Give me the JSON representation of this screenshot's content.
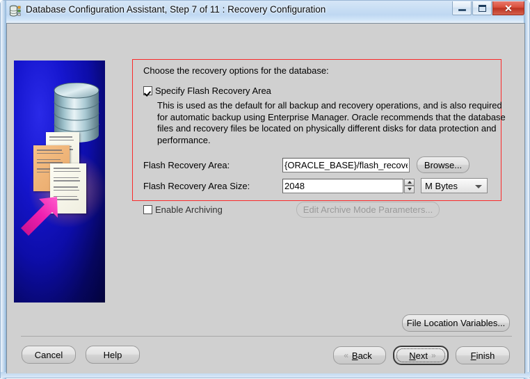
{
  "window": {
    "title": "Database Configuration Assistant, Step 7 of 11 : Recovery Configuration",
    "icon": "database-icon",
    "controls": {
      "minimize": "minimize-icon",
      "maximize": "maximize-icon",
      "close": "✕"
    }
  },
  "content": {
    "prompt": "Choose the recovery options for the database:",
    "specify_flash_recovery_area": {
      "label": "Specify Flash Recovery Area",
      "checked": true
    },
    "description": "This is used as the default for all backup and recovery operations, and is also required for automatic backup using Enterprise Manager. Oracle recommends that the database files and recovery files be located on physically different disks for data protection and performance.",
    "fields": [
      {
        "label": "Flash Recovery Area:",
        "value": "{ORACLE_BASE}/flash_recovery_",
        "button": "Browse..."
      },
      {
        "label": "Flash Recovery Area Size:",
        "value": "2048",
        "unit": "M Bytes"
      }
    ],
    "enable_archiving": {
      "label": "Enable Archiving",
      "checked": false
    },
    "edit_archive_button": {
      "label": "Edit Archive Mode Parameters...",
      "enabled": false
    },
    "file_location_variables_button": "File Location Variables..."
  },
  "footer": {
    "cancel": "Cancel",
    "help": "Help",
    "back": "Back",
    "next": "Next",
    "finish": "Finish",
    "back_arrow": "«",
    "next_arrow": "»"
  },
  "colors": {
    "annotation": "#fa2a2a",
    "dialog_bg": "#d0d0d0",
    "title_glass": "#cfe2f5"
  }
}
